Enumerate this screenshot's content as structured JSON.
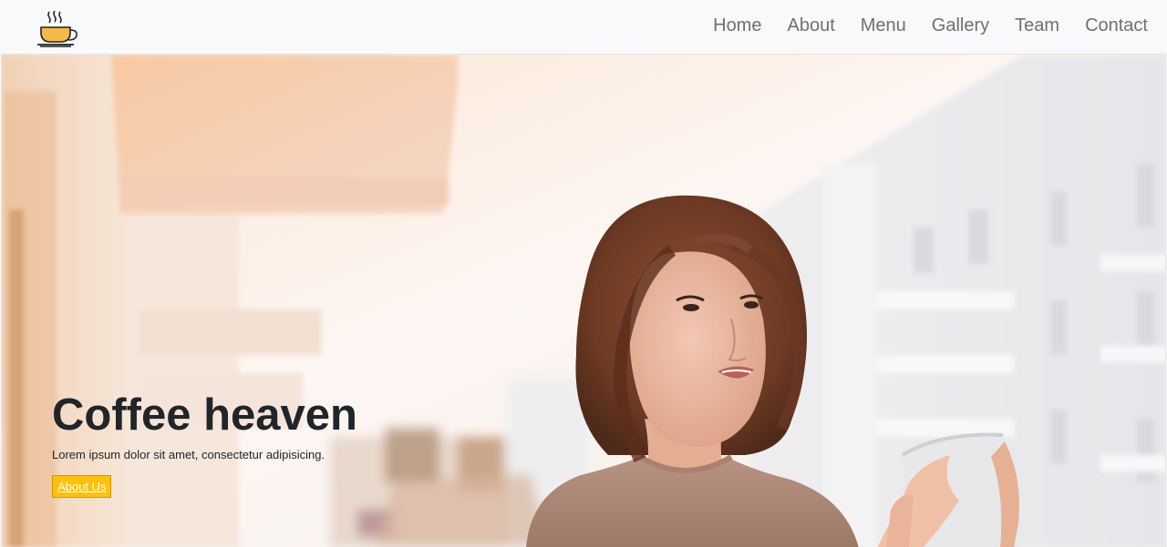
{
  "navbar": {
    "logo_icon": "coffee-cup-icon",
    "links": [
      {
        "label": "Home"
      },
      {
        "label": "About"
      },
      {
        "label": "Menu"
      },
      {
        "label": "Gallery"
      },
      {
        "label": "Team"
      },
      {
        "label": "Contact"
      }
    ]
  },
  "hero": {
    "title": "Coffee heaven",
    "subtitle": "Lorem ipsum dolor sit amet, consectetur adipisicing.",
    "button_label": "About Us",
    "image": "woman-drinking-coffee-on-balcony-photo"
  },
  "colors": {
    "accent": "#ffc107",
    "nav_text": "#707070",
    "heading": "#212529",
    "navbar_bg": "#f8f9fa"
  }
}
